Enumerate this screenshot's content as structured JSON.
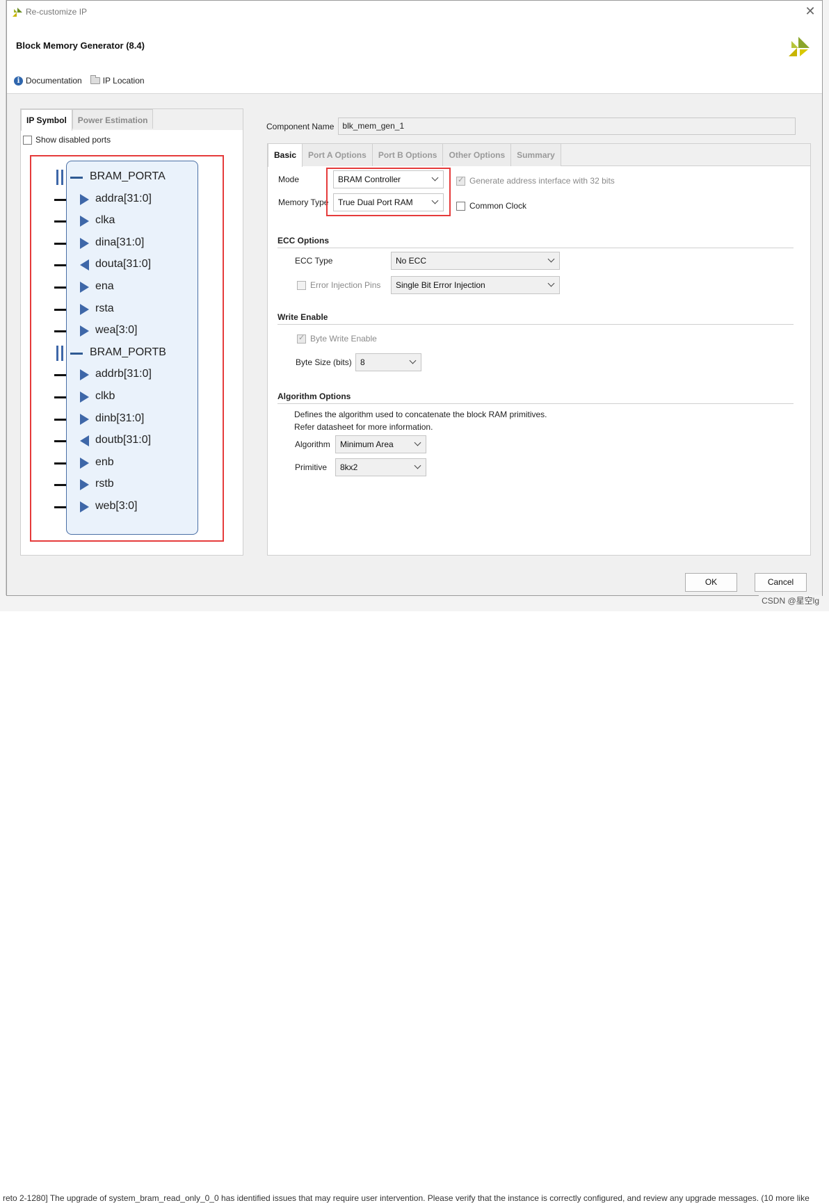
{
  "window": {
    "title": "Re-customize IP"
  },
  "header": {
    "heading": "Block Memory Generator (8.4)",
    "documentation": "Documentation",
    "ip_location": "IP Location"
  },
  "left_tabs": [
    "IP Symbol",
    "Power Estimation"
  ],
  "show_disabled_ports": "Show disabled ports",
  "symbol": {
    "ports": [
      {
        "name": "BRAM_PORTA",
        "kind": "bus"
      },
      {
        "name": "addra[31:0]",
        "kind": "in"
      },
      {
        "name": "clka",
        "kind": "in"
      },
      {
        "name": "dina[31:0]",
        "kind": "in"
      },
      {
        "name": "douta[31:0]",
        "kind": "out"
      },
      {
        "name": "ena",
        "kind": "in"
      },
      {
        "name": "rsta",
        "kind": "in"
      },
      {
        "name": "wea[3:0]",
        "kind": "in"
      },
      {
        "name": "BRAM_PORTB",
        "kind": "bus"
      },
      {
        "name": "addrb[31:0]",
        "kind": "in"
      },
      {
        "name": "clkb",
        "kind": "in"
      },
      {
        "name": "dinb[31:0]",
        "kind": "in"
      },
      {
        "name": "doutb[31:0]",
        "kind": "out"
      },
      {
        "name": "enb",
        "kind": "in"
      },
      {
        "name": "rstb",
        "kind": "in"
      },
      {
        "name": "web[3:0]",
        "kind": "in"
      }
    ]
  },
  "component": {
    "label": "Component Name",
    "value": "blk_mem_gen_1"
  },
  "right_tabs": [
    "Basic",
    "Port A Options",
    "Port B Options",
    "Other Options",
    "Summary"
  ],
  "basic": {
    "mode_label": "Mode",
    "mode_value": "BRAM Controller",
    "memory_type_label": "Memory Type",
    "memory_type_value": "True Dual Port RAM",
    "gen_addr_label": "Generate address interface with 32 bits",
    "common_clock_label": "Common Clock",
    "ecc_section": "ECC Options",
    "ecc_type_label": "ECC Type",
    "ecc_type_value": "No ECC",
    "error_injection_label": "Error Injection Pins",
    "error_injection_value": "Single Bit Error Injection",
    "write_enable_section": "Write Enable",
    "byte_write_enable_label": "Byte Write Enable",
    "byte_size_label": "Byte Size (bits)",
    "byte_size_value": "8",
    "algorithm_section": "Algorithm Options",
    "algorithm_desc_1": "Defines the algorithm used to concatenate the block RAM primitives.",
    "algorithm_desc_2": "Refer datasheet for more information.",
    "algorithm_label": "Algorithm",
    "algorithm_value": "Minimum Area",
    "primitive_label": "Primitive",
    "primitive_value": "8kx2"
  },
  "buttons": {
    "ok": "OK",
    "cancel": "Cancel"
  },
  "background": {
    "message": "reto 2-1280] The upgrade of system_bram_read_only_0_0 has identified issues that may require user intervention. Please verify that the instance is correctly configured, and review any upgrade messages. (10 more like",
    "watermark": "CSDN @星空lg"
  },
  "colors": {
    "accent": "#3e67a8",
    "highlight": "#e53b3b"
  }
}
